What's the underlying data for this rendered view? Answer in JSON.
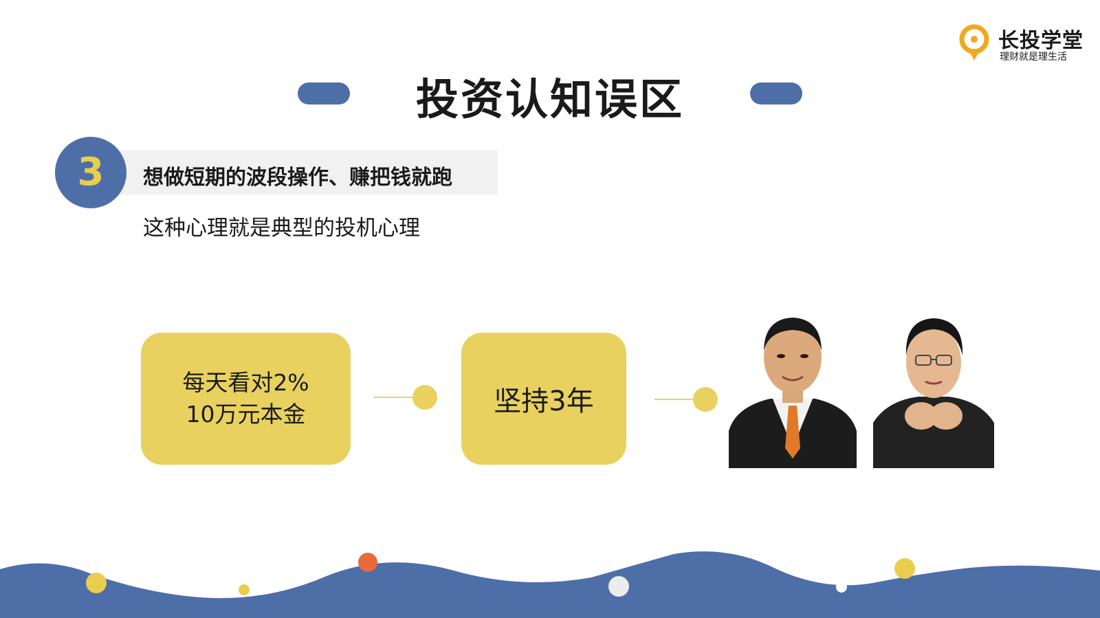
{
  "brand": {
    "name": "长投学堂",
    "slogan": "理财就是理生活",
    "colors": {
      "primary": "#4e6ea8",
      "accent": "#e8cd4e",
      "logo_orange": "#f2a81d"
    }
  },
  "slide": {
    "title": "投资认知误区",
    "section_number": "3",
    "heading": "想做短期的波段操作、赚把钱就跑",
    "subtitle": "这种心理就是典型的投机心理"
  },
  "flow": {
    "box1_line1": "每天看对2%",
    "box1_line2": "10万元本金",
    "box2": "坚持3年"
  },
  "icons": {
    "logo": "lightbulb-logo-icon",
    "person_left": "man-in-suit-portrait",
    "person_right": "man-with-glasses-portrait"
  }
}
